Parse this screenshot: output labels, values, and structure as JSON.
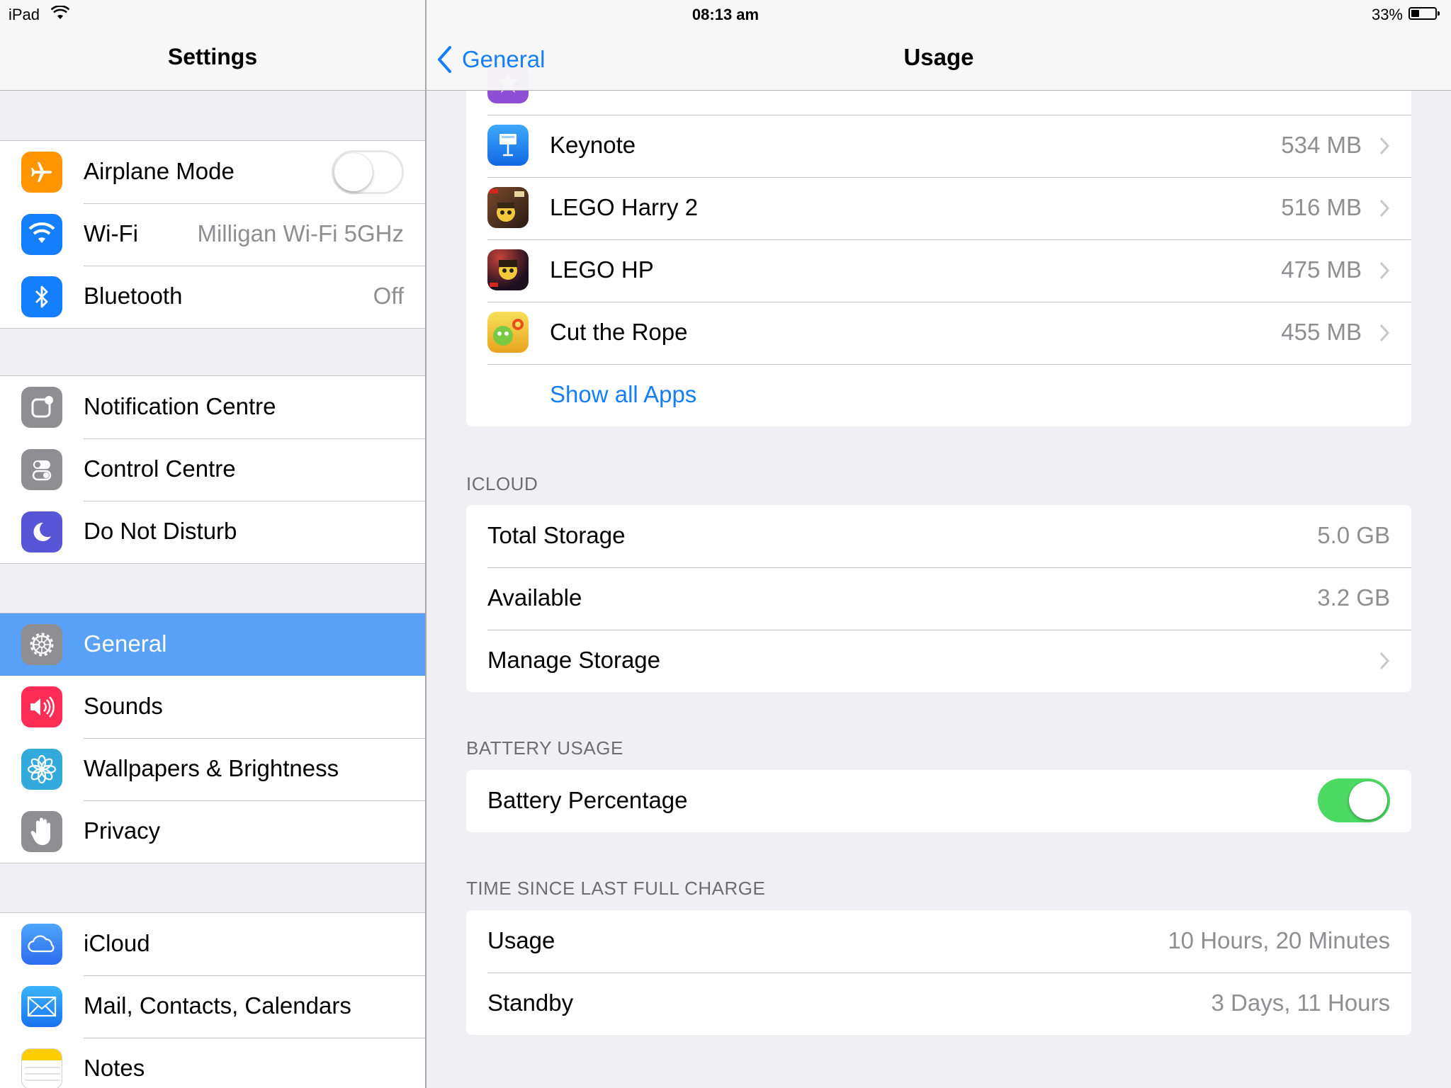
{
  "status_bar": {
    "carrier": "iPad",
    "time": "08:13 am",
    "battery_percent": "33%",
    "battery_level": 0.33
  },
  "master": {
    "title": "Settings",
    "groups": [
      [
        {
          "label": "Airplane Mode",
          "icon": "airplane-icon",
          "color": "#ff9500",
          "toggle": false
        },
        {
          "label": "Wi-Fi",
          "icon": "wifi-icon",
          "color": "#147efb",
          "value": "Milligan Wi-Fi 5GHz"
        },
        {
          "label": "Bluetooth",
          "icon": "bluetooth-icon",
          "color": "#147efb",
          "value": "Off"
        }
      ],
      [
        {
          "label": "Notification Centre",
          "icon": "notification-centre-icon",
          "color": "#8e8e93"
        },
        {
          "label": "Control Centre",
          "icon": "control-centre-icon",
          "color": "#8e8e93"
        },
        {
          "label": "Do Not Disturb",
          "icon": "moon-icon",
          "color": "#5856d6"
        }
      ],
      [
        {
          "label": "General",
          "icon": "gear-icon",
          "color": "#8e8e93",
          "selected": true
        },
        {
          "label": "Sounds",
          "icon": "speaker-icon",
          "color": "#ff2d55"
        },
        {
          "label": "Wallpapers & Brightness",
          "icon": "flower-icon",
          "color": "#34aadc"
        },
        {
          "label": "Privacy",
          "icon": "hand-icon",
          "color": "#8e8e93"
        }
      ],
      [
        {
          "label": "iCloud",
          "icon": "cloud-icon",
          "color": "#147efb"
        },
        {
          "label": "Mail, Contacts, Calendars",
          "icon": "mail-icon",
          "color": "#147efb"
        },
        {
          "label": "Notes",
          "icon": "notes-icon",
          "color": "#ffcc00"
        }
      ]
    ]
  },
  "detail": {
    "back_label": "General",
    "title": "Usage",
    "apps": [
      {
        "name": "Keynote",
        "size": "534 MB",
        "icon": "keynote-icon"
      },
      {
        "name": "LEGO Harry 2",
        "size": "516 MB",
        "icon": "lego-harry-2-icon"
      },
      {
        "name": "LEGO HP",
        "size": "475 MB",
        "icon": "lego-hp-icon"
      },
      {
        "name": "Cut the Rope",
        "size": "455 MB",
        "icon": "cut-the-rope-icon"
      }
    ],
    "show_all_apps": "Show all Apps",
    "icloud": {
      "header": "ICLOUD",
      "total_label": "Total Storage",
      "total_value": "5.0 GB",
      "available_label": "Available",
      "available_value": "3.2 GB",
      "manage_label": "Manage Storage"
    },
    "battery": {
      "header": "BATTERY USAGE",
      "percentage_label": "Battery Percentage",
      "percentage_on": true
    },
    "charge": {
      "header": "TIME SINCE LAST FULL CHARGE",
      "usage_label": "Usage",
      "usage_value": "10 Hours, 20 Minutes",
      "standby_label": "Standby",
      "standby_value": "3 Days, 11 Hours"
    }
  }
}
